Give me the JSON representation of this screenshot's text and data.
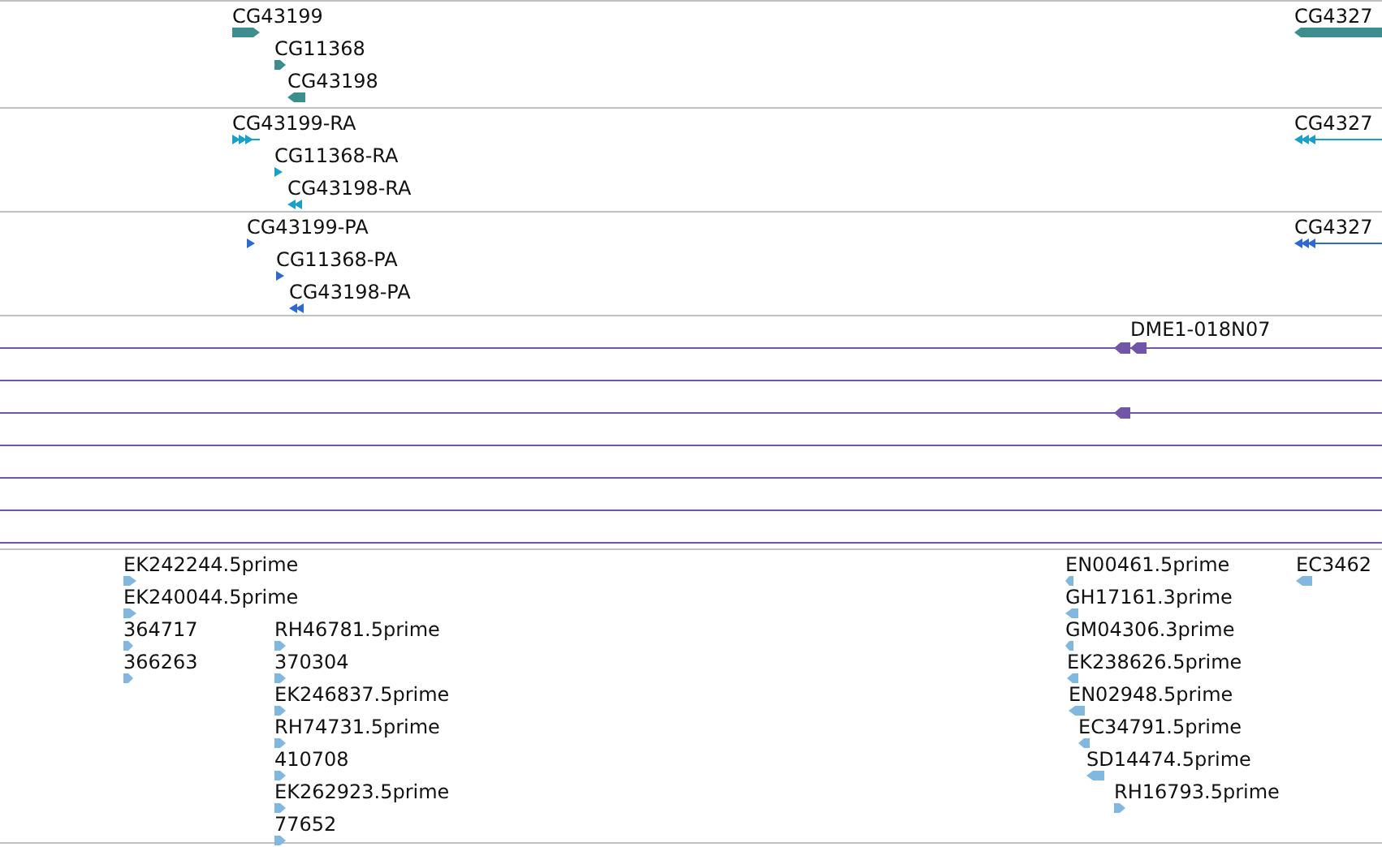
{
  "tracks": [
    {
      "kind": "gene",
      "color": "#3d8f8f",
      "features": [
        {
          "label": "CG43199",
          "reverse": false
        },
        {
          "label": "CG11368",
          "reverse": false
        },
        {
          "label": "CG43198",
          "reverse": true
        },
        {
          "label": "CG4327",
          "reverse": true
        }
      ]
    },
    {
      "kind": "transcript",
      "color": "#1aa0c8",
      "features": [
        {
          "label": "CG43199-RA",
          "reverse": false
        },
        {
          "label": "CG11368-RA",
          "reverse": false
        },
        {
          "label": "CG43198-RA",
          "reverse": true
        },
        {
          "label": "CG4327",
          "reverse": true
        }
      ]
    },
    {
      "kind": "transcript",
      "color": "#2d6acf",
      "features": [
        {
          "label": "CG43199-PA",
          "reverse": false
        },
        {
          "label": "CG11368-PA",
          "reverse": false
        },
        {
          "label": "CG43198-PA",
          "reverse": true
        },
        {
          "label": "CG4327",
          "reverse": true
        }
      ]
    },
    {
      "kind": "lanes",
      "color": "#7055a8",
      "features": [
        {
          "label": "DME1-018N07",
          "reverse": true
        },
        {
          "reverse": true
        }
      ]
    },
    {
      "kind": "est",
      "color": "#82b8e0",
      "features": [
        {
          "label": "EK242244.5prime",
          "reverse": false
        },
        {
          "label": "EK240044.5prime",
          "reverse": false
        },
        {
          "label": "364717",
          "reverse": false
        },
        {
          "label": "366263",
          "reverse": false
        },
        {
          "label": "RH46781.5prime",
          "reverse": false
        },
        {
          "label": "370304",
          "reverse": false
        },
        {
          "label": "EK246837.5prime",
          "reverse": false
        },
        {
          "label": "RH74731.5prime",
          "reverse": false
        },
        {
          "label": "410708",
          "reverse": false
        },
        {
          "label": "EK262923.5prime",
          "reverse": false
        },
        {
          "label": "77652",
          "reverse": false
        },
        {
          "label": "EN00461.5prime",
          "reverse": true
        },
        {
          "label": "GH17161.3prime",
          "reverse": true
        },
        {
          "label": "GM04306.3prime",
          "reverse": true
        },
        {
          "label": "EK238626.5prime",
          "reverse": true
        },
        {
          "label": "EN02948.5prime",
          "reverse": true
        },
        {
          "label": "EC34791.5prime",
          "reverse": true
        },
        {
          "label": "SD14474.5prime",
          "reverse": true
        },
        {
          "label": "RH16793.5prime",
          "reverse": false
        },
        {
          "label": "EC3462",
          "reverse": true
        }
      ]
    }
  ]
}
